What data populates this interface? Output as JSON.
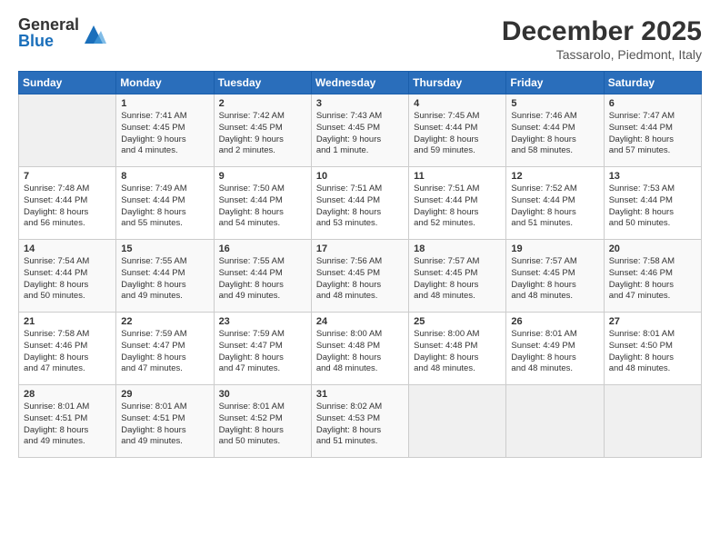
{
  "logo": {
    "general": "General",
    "blue": "Blue"
  },
  "title": {
    "month": "December 2025",
    "location": "Tassarolo, Piedmont, Italy"
  },
  "headers": [
    "Sunday",
    "Monday",
    "Tuesday",
    "Wednesday",
    "Thursday",
    "Friday",
    "Saturday"
  ],
  "weeks": [
    [
      {
        "day": "",
        "info": ""
      },
      {
        "day": "1",
        "info": "Sunrise: 7:41 AM\nSunset: 4:45 PM\nDaylight: 9 hours\nand 4 minutes."
      },
      {
        "day": "2",
        "info": "Sunrise: 7:42 AM\nSunset: 4:45 PM\nDaylight: 9 hours\nand 2 minutes."
      },
      {
        "day": "3",
        "info": "Sunrise: 7:43 AM\nSunset: 4:45 PM\nDaylight: 9 hours\nand 1 minute."
      },
      {
        "day": "4",
        "info": "Sunrise: 7:45 AM\nSunset: 4:44 PM\nDaylight: 8 hours\nand 59 minutes."
      },
      {
        "day": "5",
        "info": "Sunrise: 7:46 AM\nSunset: 4:44 PM\nDaylight: 8 hours\nand 58 minutes."
      },
      {
        "day": "6",
        "info": "Sunrise: 7:47 AM\nSunset: 4:44 PM\nDaylight: 8 hours\nand 57 minutes."
      }
    ],
    [
      {
        "day": "7",
        "info": "Sunrise: 7:48 AM\nSunset: 4:44 PM\nDaylight: 8 hours\nand 56 minutes."
      },
      {
        "day": "8",
        "info": "Sunrise: 7:49 AM\nSunset: 4:44 PM\nDaylight: 8 hours\nand 55 minutes."
      },
      {
        "day": "9",
        "info": "Sunrise: 7:50 AM\nSunset: 4:44 PM\nDaylight: 8 hours\nand 54 minutes."
      },
      {
        "day": "10",
        "info": "Sunrise: 7:51 AM\nSunset: 4:44 PM\nDaylight: 8 hours\nand 53 minutes."
      },
      {
        "day": "11",
        "info": "Sunrise: 7:51 AM\nSunset: 4:44 PM\nDaylight: 8 hours\nand 52 minutes."
      },
      {
        "day": "12",
        "info": "Sunrise: 7:52 AM\nSunset: 4:44 PM\nDaylight: 8 hours\nand 51 minutes."
      },
      {
        "day": "13",
        "info": "Sunrise: 7:53 AM\nSunset: 4:44 PM\nDaylight: 8 hours\nand 50 minutes."
      }
    ],
    [
      {
        "day": "14",
        "info": "Sunrise: 7:54 AM\nSunset: 4:44 PM\nDaylight: 8 hours\nand 50 minutes."
      },
      {
        "day": "15",
        "info": "Sunrise: 7:55 AM\nSunset: 4:44 PM\nDaylight: 8 hours\nand 49 minutes."
      },
      {
        "day": "16",
        "info": "Sunrise: 7:55 AM\nSunset: 4:44 PM\nDaylight: 8 hours\nand 49 minutes."
      },
      {
        "day": "17",
        "info": "Sunrise: 7:56 AM\nSunset: 4:45 PM\nDaylight: 8 hours\nand 48 minutes."
      },
      {
        "day": "18",
        "info": "Sunrise: 7:57 AM\nSunset: 4:45 PM\nDaylight: 8 hours\nand 48 minutes."
      },
      {
        "day": "19",
        "info": "Sunrise: 7:57 AM\nSunset: 4:45 PM\nDaylight: 8 hours\nand 48 minutes."
      },
      {
        "day": "20",
        "info": "Sunrise: 7:58 AM\nSunset: 4:46 PM\nDaylight: 8 hours\nand 47 minutes."
      }
    ],
    [
      {
        "day": "21",
        "info": "Sunrise: 7:58 AM\nSunset: 4:46 PM\nDaylight: 8 hours\nand 47 minutes."
      },
      {
        "day": "22",
        "info": "Sunrise: 7:59 AM\nSunset: 4:47 PM\nDaylight: 8 hours\nand 47 minutes."
      },
      {
        "day": "23",
        "info": "Sunrise: 7:59 AM\nSunset: 4:47 PM\nDaylight: 8 hours\nand 47 minutes."
      },
      {
        "day": "24",
        "info": "Sunrise: 8:00 AM\nSunset: 4:48 PM\nDaylight: 8 hours\nand 48 minutes."
      },
      {
        "day": "25",
        "info": "Sunrise: 8:00 AM\nSunset: 4:48 PM\nDaylight: 8 hours\nand 48 minutes."
      },
      {
        "day": "26",
        "info": "Sunrise: 8:01 AM\nSunset: 4:49 PM\nDaylight: 8 hours\nand 48 minutes."
      },
      {
        "day": "27",
        "info": "Sunrise: 8:01 AM\nSunset: 4:50 PM\nDaylight: 8 hours\nand 48 minutes."
      }
    ],
    [
      {
        "day": "28",
        "info": "Sunrise: 8:01 AM\nSunset: 4:51 PM\nDaylight: 8 hours\nand 49 minutes."
      },
      {
        "day": "29",
        "info": "Sunrise: 8:01 AM\nSunset: 4:51 PM\nDaylight: 8 hours\nand 49 minutes."
      },
      {
        "day": "30",
        "info": "Sunrise: 8:01 AM\nSunset: 4:52 PM\nDaylight: 8 hours\nand 50 minutes."
      },
      {
        "day": "31",
        "info": "Sunrise: 8:02 AM\nSunset: 4:53 PM\nDaylight: 8 hours\nand 51 minutes."
      },
      {
        "day": "",
        "info": ""
      },
      {
        "day": "",
        "info": ""
      },
      {
        "day": "",
        "info": ""
      }
    ]
  ]
}
